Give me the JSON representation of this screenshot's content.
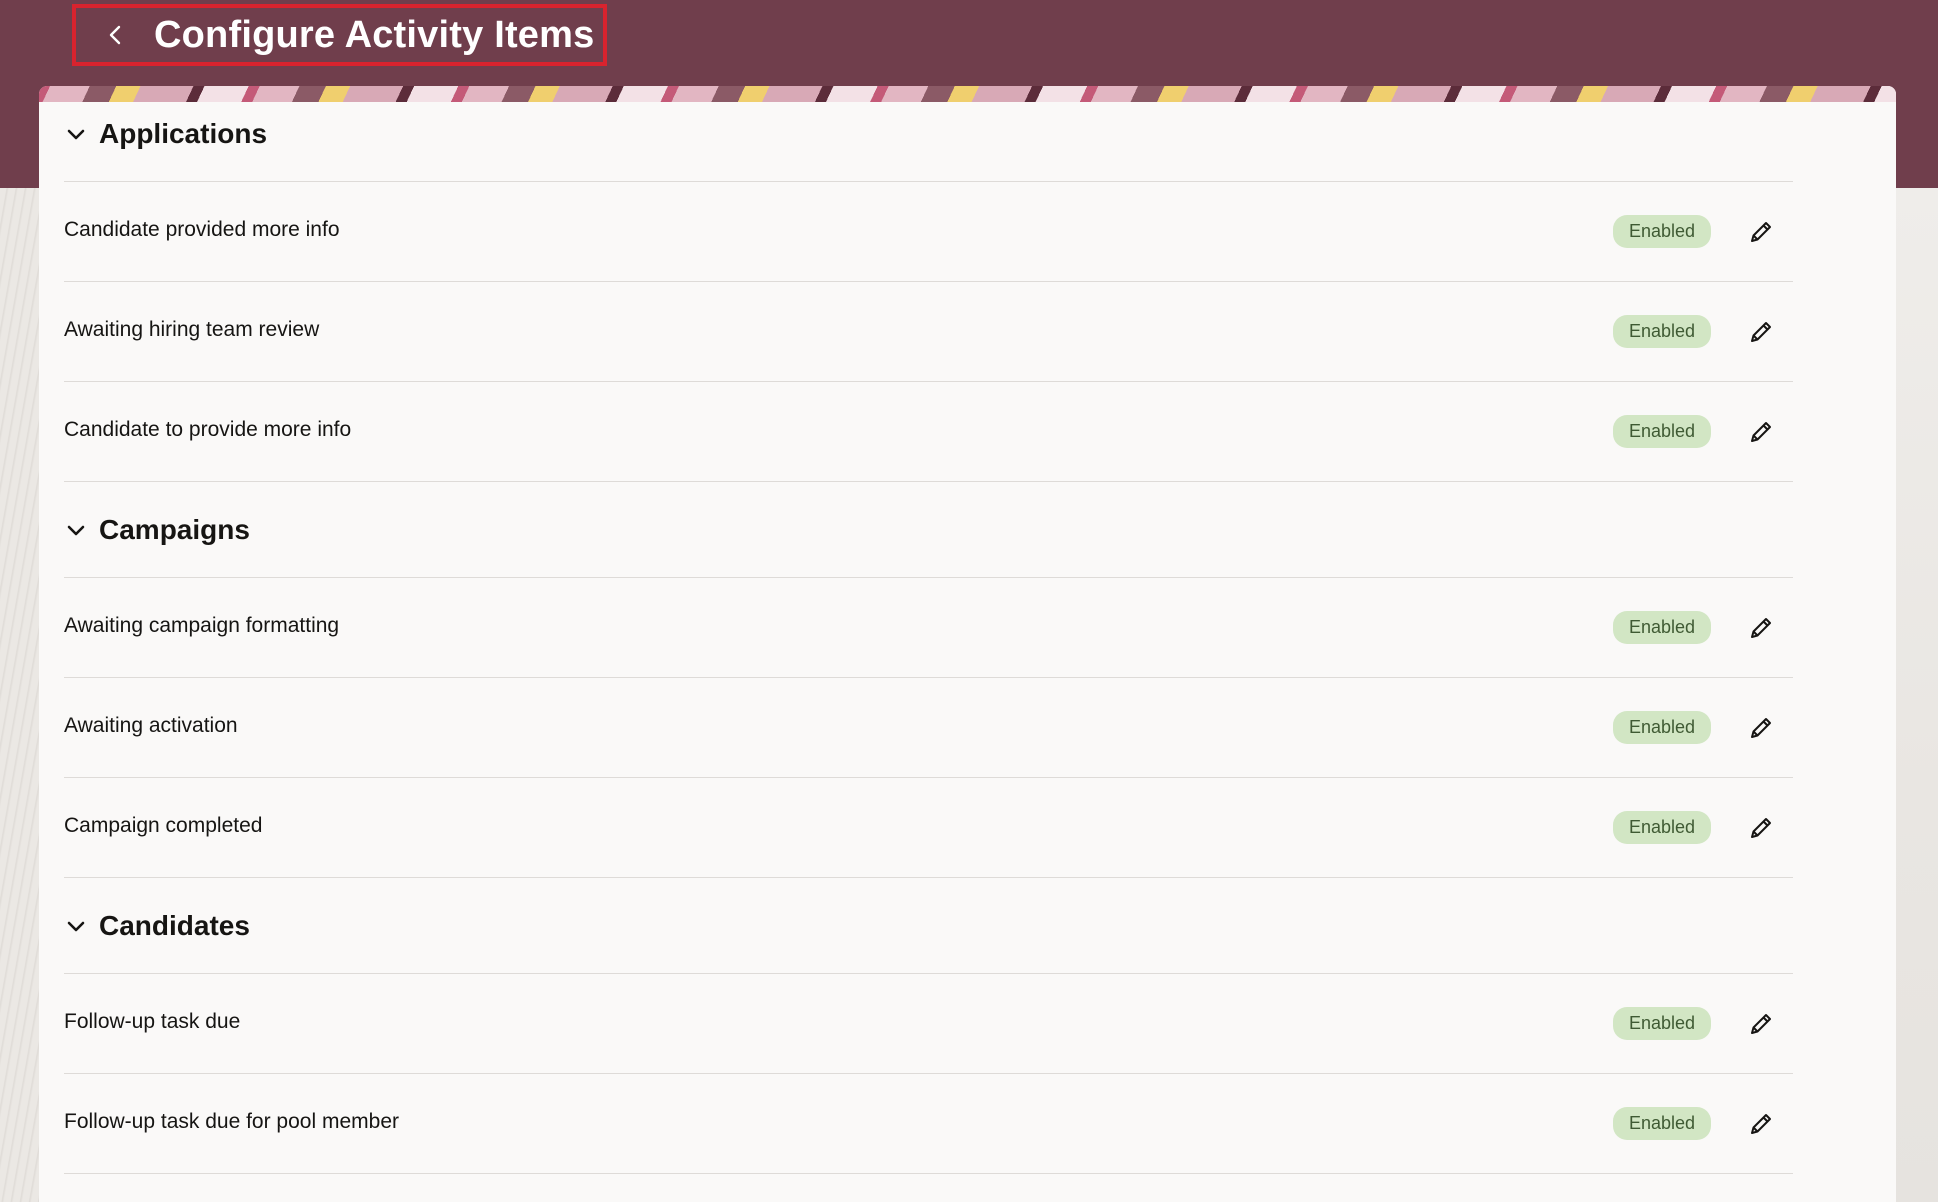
{
  "header": {
    "title": "Configure Activity Items",
    "back_icon": "chevron-left-icon"
  },
  "colors": {
    "header_bg": "#703e4c",
    "highlight_border": "#d9232e",
    "badge_bg": "#d2e6c4",
    "badge_text": "#3f5a33"
  },
  "sections": [
    {
      "title": "Applications",
      "items": [
        {
          "label": "Candidate provided more info",
          "status": "Enabled"
        },
        {
          "label": "Awaiting hiring team review",
          "status": "Enabled"
        },
        {
          "label": "Candidate to provide more info",
          "status": "Enabled"
        }
      ]
    },
    {
      "title": "Campaigns",
      "items": [
        {
          "label": "Awaiting campaign formatting",
          "status": "Enabled"
        },
        {
          "label": "Awaiting activation",
          "status": "Enabled"
        },
        {
          "label": "Campaign completed",
          "status": "Enabled"
        }
      ]
    },
    {
      "title": "Candidates",
      "items": [
        {
          "label": "Follow-up task due",
          "status": "Enabled"
        },
        {
          "label": "Follow-up task due for pool member",
          "status": "Enabled"
        }
      ]
    }
  ]
}
